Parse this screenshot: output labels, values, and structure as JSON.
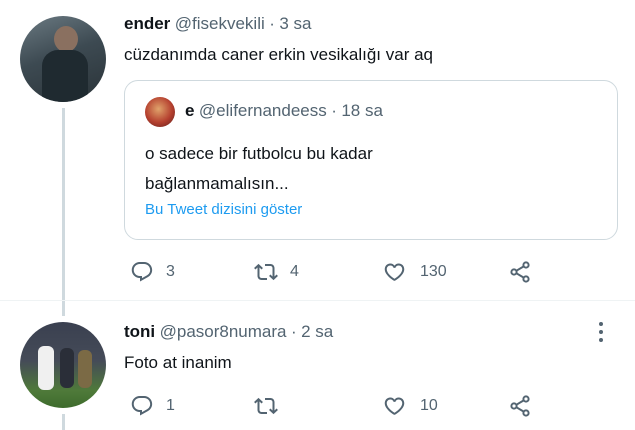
{
  "tweets": [
    {
      "name": "ender",
      "handle": "@fisekvekili",
      "sep": "·",
      "time": "3 sa",
      "text": "cüzdanımda caner erkin vesikalığı var aq",
      "quote": {
        "name": "e",
        "handle": "@elifernandeess",
        "sep": "·",
        "time": "18 sa",
        "text_line1": "o sadece bir futbolcu bu kadar",
        "text_line2": "bağlanmamalısın...",
        "link": "Bu Tweet dizisini göster"
      },
      "reply_count": "3",
      "retweet_count": "4",
      "like_count": "130"
    },
    {
      "name": "toni",
      "handle": "@pasor8numara",
      "sep": "·",
      "time": "2 sa",
      "text": "Foto at inanim",
      "reply_count": "1",
      "retweet_count": "",
      "like_count": "10"
    }
  ],
  "icons": [
    "reply-icon",
    "retweet-icon",
    "like-icon",
    "share-icon",
    "more-icon"
  ],
  "colors": {
    "accent": "#1d9bf0",
    "secondary_text": "#536471",
    "border": "#cfd9de"
  }
}
